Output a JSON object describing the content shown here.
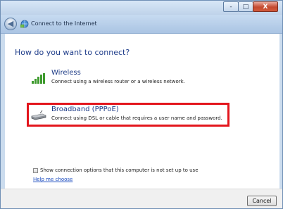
{
  "window": {
    "title": "Connect to the Internet",
    "controls": {
      "minimize": "-",
      "maximize": "□",
      "close": "X"
    }
  },
  "main": {
    "heading": "How do you want to connect?",
    "options": [
      {
        "title": "Wireless",
        "description": "Connect using a wireless router or a wireless network.",
        "icon": "wireless-signal-icon"
      },
      {
        "title": "Broadband (PPPoE)",
        "description": "Connect using DSL or cable that requires a user name and password.",
        "icon": "broadband-modem-icon",
        "highlighted": true
      }
    ],
    "show_options_label": "Show connection options that this computer is not set up to use",
    "show_options_checked": false,
    "help_link": "Help me choose"
  },
  "footer": {
    "cancel_label": "Cancel"
  },
  "colors": {
    "highlight": "#e3161d",
    "heading": "#1f3d8a",
    "link": "#1a4bbf"
  }
}
